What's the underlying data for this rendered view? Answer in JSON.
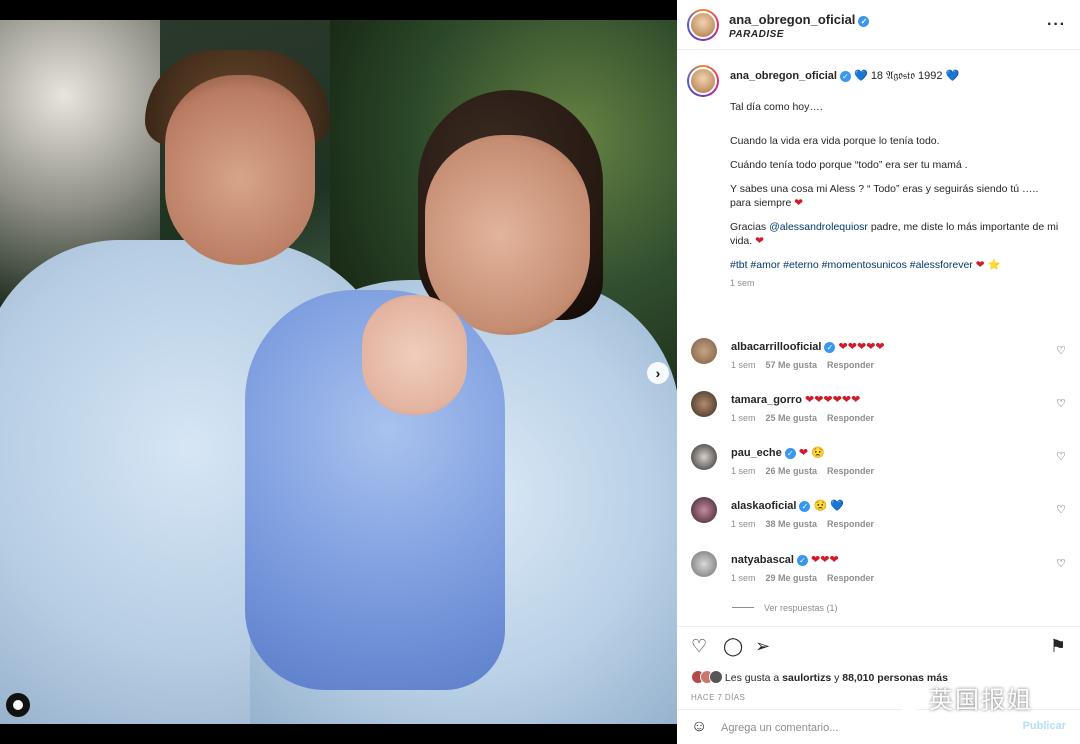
{
  "post": {
    "username": "ana_obregon_oficial",
    "location": "PARADISE",
    "more_icon": "more-options-icon"
  },
  "caption": {
    "username": "ana_obregon_oficial",
    "date_line": "18 𝔄𝔤𝔬𝔰𝔱𝔬 1992",
    "line1": "Tal día como hoy….",
    "line2": "Cuando la vida era vida porque lo tenía todo.",
    "line3": "Cuándo tenía todo porque “todo” era ser tu mamá .",
    "line4": "Y sabes una cosa mi Aless ? “ Todo” eras y seguirás siendo tú ….. para siempre",
    "line5_pre": "Gracias",
    "line5_mention": "@alessandrolequiosr",
    "line5_post": "padre, me diste lo más importante de mi vida.",
    "hashtags": "#tbt #amor #eterno #momentosunicos #alessforever",
    "time": "1 sem"
  },
  "comments": [
    {
      "user": "albacarrillooficial",
      "text": "❤❤❤❤❤",
      "time": "1 sem",
      "likes": "57 Me gusta",
      "reply": "Responder"
    },
    {
      "user": "tamara_gorro",
      "text": "❤❤❤❤❤❤",
      "time": "1 sem",
      "likes": "25 Me gusta",
      "reply": "Responder"
    },
    {
      "user": "pau_eche",
      "text": "❤ 😟",
      "time": "1 sem",
      "likes": "26 Me gusta",
      "reply": "Responder"
    },
    {
      "user": "alaskaoficial",
      "text": "😟 💙",
      "time": "1 sem",
      "likes": "38 Me gusta",
      "reply": "Responder"
    },
    {
      "user": "natyabascal",
      "text": "❤❤❤",
      "time": "1 sem",
      "likes": "29 Me gusta",
      "reply": "Responder"
    }
  ],
  "view_replies": "Ver respuestas (1)",
  "likes": {
    "prefix": "Les gusta a",
    "user": "saulortizs",
    "middle": "y",
    "count": "88,010",
    "suffix": "personas más"
  },
  "post_age": "HACE 7 DÍAS",
  "add_comment": {
    "placeholder": "Agrega un comentario...",
    "publish": "Publicar"
  },
  "watermark": "英国报姐",
  "colors": {
    "verified": "#3897f0",
    "link": "#00376b",
    "publish_disabled": "#b2dffc"
  }
}
